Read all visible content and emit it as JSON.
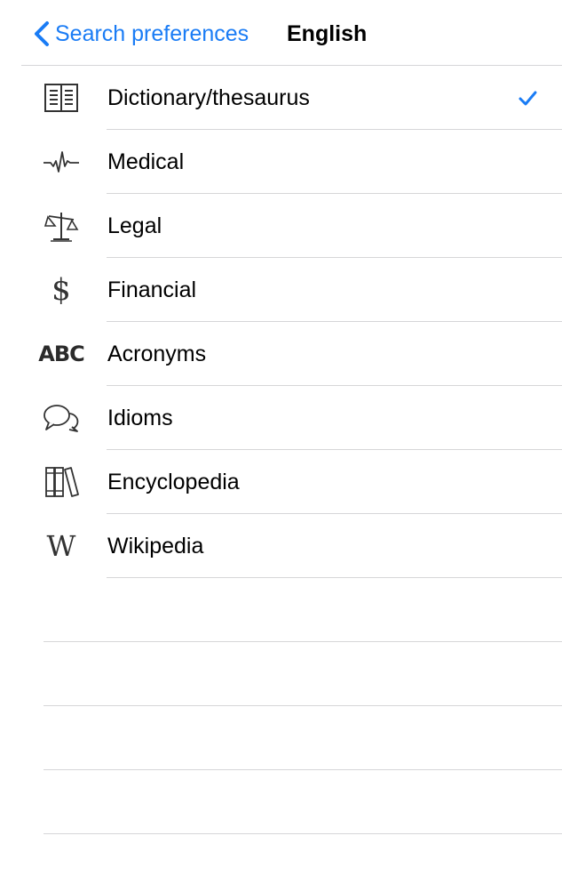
{
  "nav": {
    "back_label": "Search preferences",
    "title": "English"
  },
  "colors": {
    "accent": "#1a7cf5",
    "separator": "#d6d6d8",
    "icon": "#333333"
  },
  "items": [
    {
      "label": "Dictionary/thesaurus",
      "icon": "open-book-icon",
      "selected": true
    },
    {
      "label": "Medical",
      "icon": "heartbeat-icon",
      "selected": false
    },
    {
      "label": "Legal",
      "icon": "scales-icon",
      "selected": false
    },
    {
      "label": "Financial",
      "icon": "dollar-icon",
      "selected": false,
      "glyph": "$"
    },
    {
      "label": "Acronyms",
      "icon": "abc-icon",
      "selected": false,
      "glyph": "ABC"
    },
    {
      "label": "Idioms",
      "icon": "speech-bubbles-icon",
      "selected": false
    },
    {
      "label": "Encyclopedia",
      "icon": "books-icon",
      "selected": false
    },
    {
      "label": "Wikipedia",
      "icon": "wikipedia-icon",
      "selected": false,
      "glyph": "W"
    }
  ]
}
